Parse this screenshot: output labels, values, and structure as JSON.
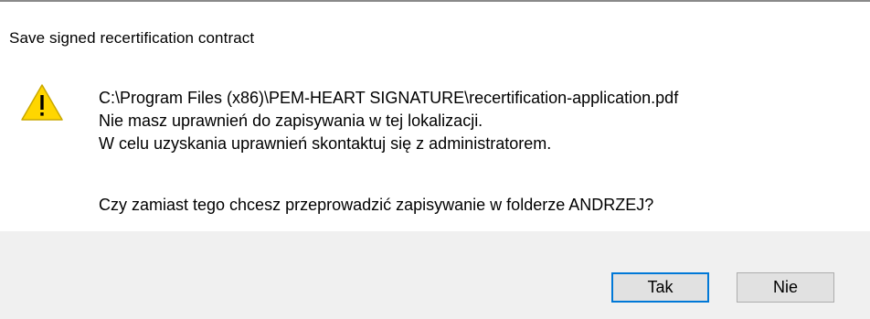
{
  "dialog": {
    "title": "Save signed recertification contract",
    "icon": "warning-icon",
    "message": {
      "path": "C:\\Program Files (x86)\\PEM-HEART SIGNATURE\\recertification-application.pdf",
      "line1": "Nie masz uprawnień do zapisywania w tej lokalizacji.",
      "line2": "W celu uzyskania uprawnień skontaktuj się z administratorem.",
      "question": "Czy zamiast tego chcesz przeprowadzić zapisywanie w folderze ANDRZEJ?"
    },
    "buttons": {
      "yes_label": "Tak",
      "no_label": "Nie"
    },
    "colors": {
      "warning_fill": "#ffd600",
      "focus_border": "#0078d7",
      "footer_bg": "#f0f0f0"
    }
  }
}
